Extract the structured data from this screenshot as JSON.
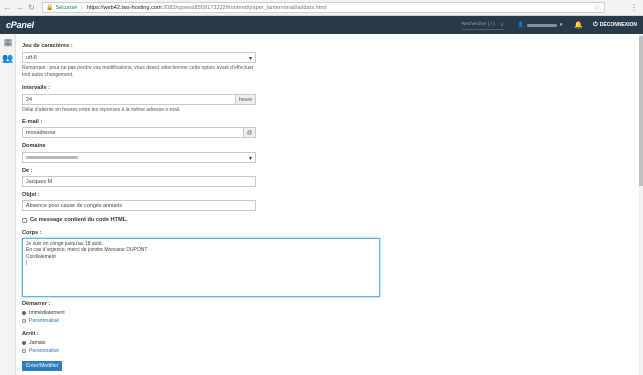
{
  "browser": {
    "secure_label": "Sécurisé",
    "url_host": "https://web42.lws-hosting.com",
    "url_path": ":2083/cpsess8559173332/frontend/paper_lantern/mail/addars.html"
  },
  "header": {
    "logo": "cPanel",
    "search_placeholder": "Rechercher ( / )",
    "logout_label": "DÉCONNEXION"
  },
  "form": {
    "charset": {
      "label": "Jeu de caractères :",
      "value": "utf-8",
      "help": "Remarque : pour ne pas perdre vos modifications, vous devez sélectionner cette option avant d’effectuer tout autre changement."
    },
    "interval": {
      "label": "Intervalle :",
      "value": "24",
      "unit": "heure",
      "help": "Délai d’attente en heures entre les réponses à la même adresse e-mail."
    },
    "email": {
      "label": "E-mail :",
      "value": "monadresse"
    },
    "domain": {
      "label": "Domaine"
    },
    "from": {
      "label": "De :",
      "value": "Jacques M"
    },
    "subject": {
      "label": "Objet :",
      "value": "Absence pour cause de congés annuels"
    },
    "html_checkbox_label": "Ce message contient du code HTML.",
    "body": {
      "label": "Corps :",
      "lines": [
        "Je suis en congé jusqu’au 18 août.",
        "En cas d’urgence, merci de joindre Monsieur DUPONT",
        "Cordialement"
      ]
    },
    "start": {
      "label": "Démarrer :",
      "option1": "Immédiatement",
      "option2": "Personnalisé"
    },
    "stop": {
      "label": "Arrêt :",
      "option1": "Jamais",
      "option2": "Personnalisé"
    },
    "submit_label": "Créer/Modifier"
  }
}
